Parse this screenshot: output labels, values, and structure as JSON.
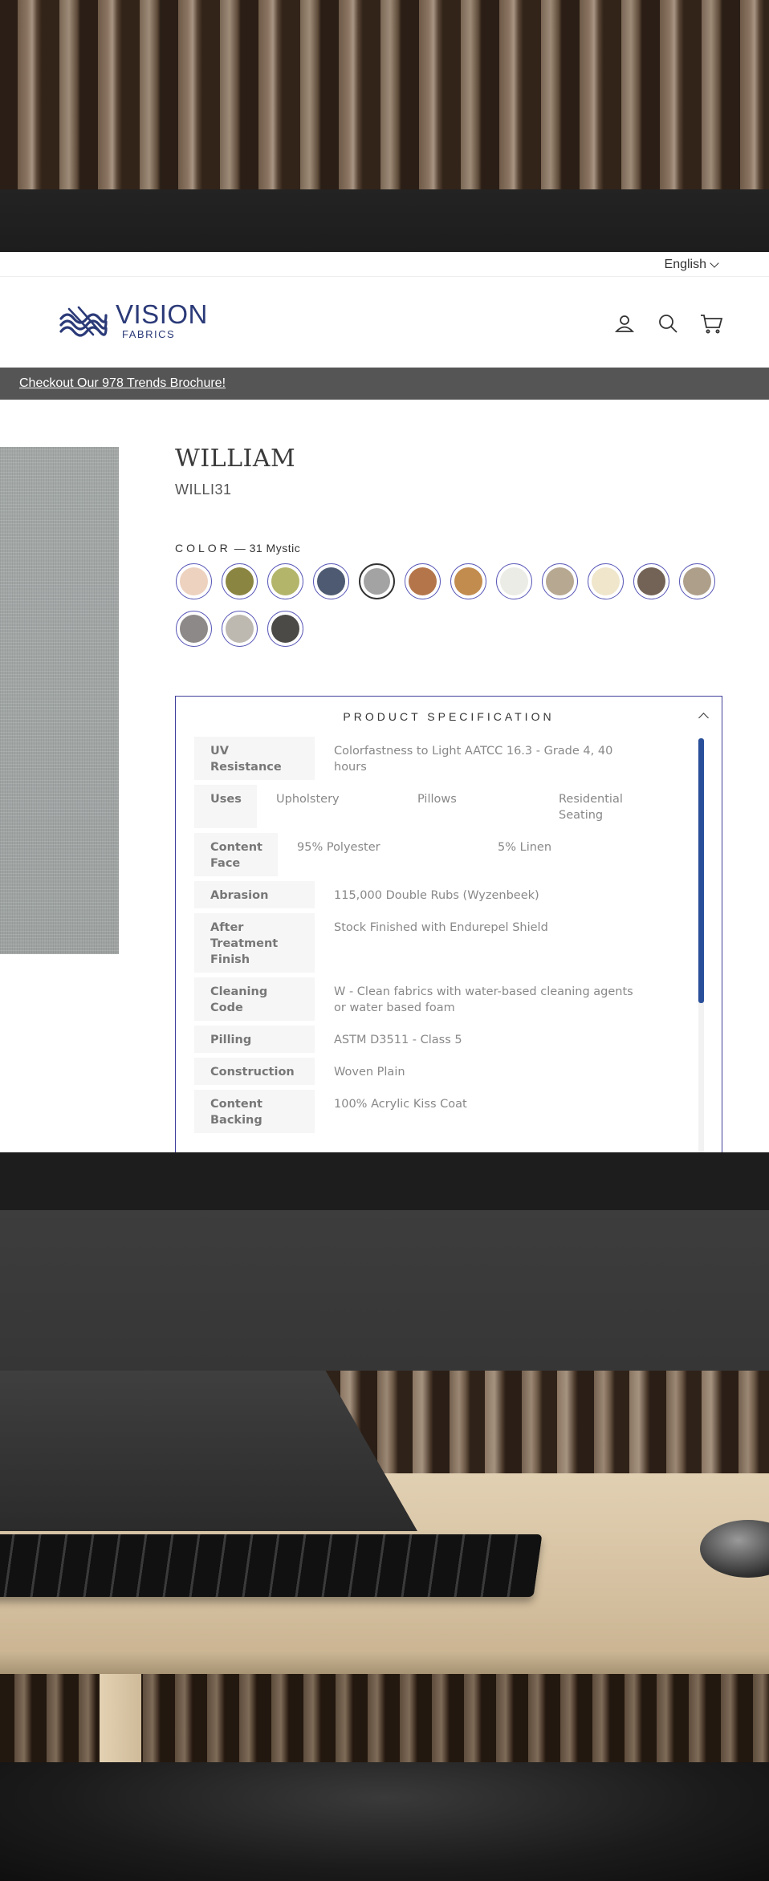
{
  "language": {
    "label": "English"
  },
  "header": {
    "logo_name": "VISION",
    "logo_sub": "FABRICS",
    "icons": [
      "account-icon",
      "search-icon",
      "cart-icon"
    ]
  },
  "announcement": {
    "text": "Checkout Our 978 Trends Brochure!"
  },
  "product": {
    "title": "WILLIAM",
    "sku": "WILLI31",
    "color_label": "COLOR",
    "color_selected": "— 31 Mystic",
    "swatches": [
      "#edd2bf",
      "#8b8542",
      "#b3b56a",
      "#4d5a72",
      "#a3a3a3",
      "#b5754a",
      "#c28c4f",
      "#ecece6",
      "#b7a892",
      "#f0e6cb",
      "#736356",
      "#ae9f8a",
      "#8d8988",
      "#bdb9b0",
      "#4b4a47"
    ],
    "selected_swatch_index": 4
  },
  "spec": {
    "title": "PRODUCT SPECIFICATION",
    "rows": [
      {
        "label": "UV Resistance",
        "values": [
          "Colorfastness to Light AATCC 16.3 - Grade 4, 40 hours"
        ]
      },
      {
        "label": "Uses",
        "values": [
          "Upholstery",
          "Pillows",
          "Residential Seating"
        ]
      },
      {
        "label": "Content Face",
        "values": [
          "95% Polyester",
          "5% Linen"
        ]
      },
      {
        "label": "Abrasion",
        "values": [
          "115,000 Double Rubs (Wyzenbeek)"
        ]
      },
      {
        "label": "After Treatment Finish",
        "values": [
          "Stock Finished with Endurepel Shield"
        ]
      },
      {
        "label": "Cleaning Code",
        "values": [
          "W - Clean fabrics with water-based cleaning agents or water based foam"
        ]
      },
      {
        "label": "Pilling",
        "values": [
          "ASTM D3511 - Class 5"
        ]
      },
      {
        "label": "Construction",
        "values": [
          "Woven Plain"
        ]
      },
      {
        "label": "Content Backing",
        "values": [
          "100% Acrylic Kiss Coat"
        ]
      }
    ]
  },
  "colors": {
    "brand": "#2b3a78",
    "accent_border": "#3e3e9a",
    "scroll_thumb": "#2a4f9a",
    "announce_bg": "#555555"
  }
}
